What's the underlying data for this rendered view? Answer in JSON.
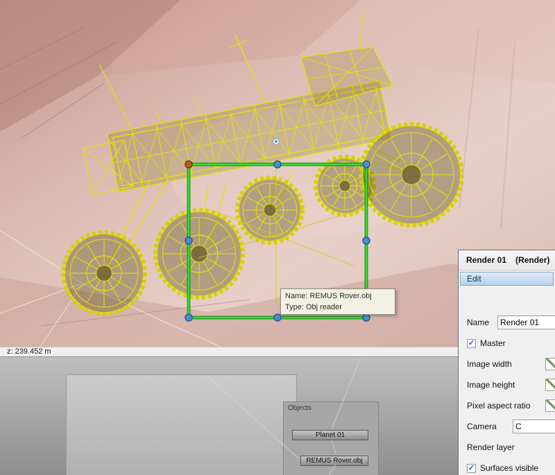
{
  "icons": {
    "checkmark": "✓"
  },
  "colors": {
    "rover_yellow": "#e9e100",
    "rover_tread": "#d7cf00",
    "selection_green": "#38d838",
    "selection_green_dark": "#1d9e1d",
    "handle_blue": "#4a8fd4",
    "handle_orange": "#c05a28",
    "terrain_base": "#d9b9b1"
  },
  "viewport": {
    "tooltip": {
      "name_line": "Name: REMUS Rover.obj",
      "type_line": "Type: Obj reader"
    }
  },
  "status_bar": {
    "z_readout": "z: 239.452 m"
  },
  "node_editor": {
    "group_label": "Objects",
    "nodes": [
      {
        "label": "Planet 01"
      },
      {
        "label": "REMUS Rover.obj"
      }
    ]
  },
  "render_panel": {
    "title": "Render 01",
    "title_suffix": "(Render)",
    "tab": "Edit",
    "rows": [
      {
        "label": "Name",
        "value": "Render 01"
      },
      {
        "label": "Master",
        "checked": true
      },
      {
        "label": "Image width"
      },
      {
        "label": "Image height"
      },
      {
        "label": "Pixel aspect ratio"
      },
      {
        "label": "Camera",
        "value": "C"
      },
      {
        "label": "Render layer"
      },
      {
        "label": "Surfaces visible",
        "checked": true
      }
    ]
  }
}
